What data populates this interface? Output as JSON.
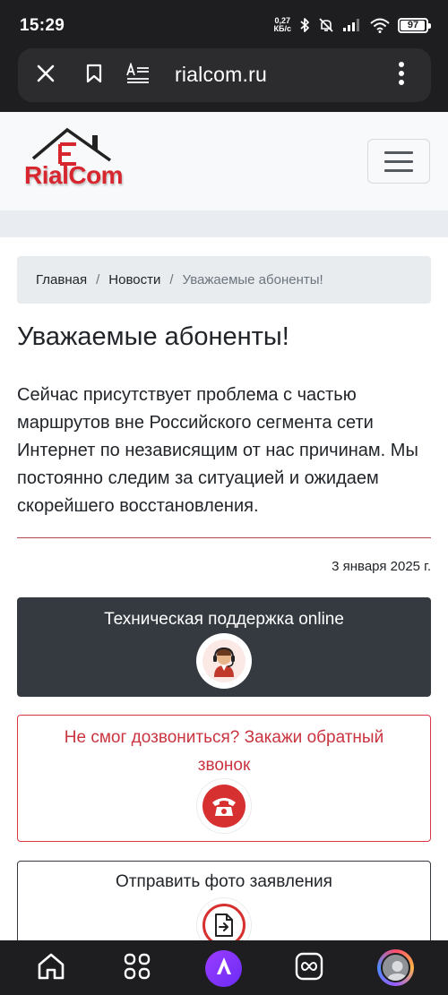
{
  "status_bar": {
    "time": "15:29",
    "net_speed_value": "0,27",
    "net_speed_unit": "КБ/с",
    "battery_level": "97",
    "icons": [
      "bluetooth-icon",
      "mute-icon",
      "signal-icon",
      "wifi-icon",
      "battery-icon"
    ]
  },
  "browser": {
    "url": "rialcom.ru",
    "icons": [
      "close-icon",
      "bookmark-icon",
      "reader-mode-icon",
      "more-vert-icon"
    ]
  },
  "header": {
    "logo_text": "RialCom",
    "menu_icon": "hamburger-menu-icon"
  },
  "breadcrumb": {
    "items": [
      "Главная",
      "Новости"
    ],
    "separator": "/",
    "current": "Уважаемые абоненты!"
  },
  "article": {
    "title": "Уважаемые абоненты!",
    "body": " Сейчас присутствует проблема с частью\nмаршрутов вне Российского сегмента сети\nИнтернет по независящим от нас причинам. Мы\nпостоянно следим за ситуацией и ожидаем\nскорейшего восстановления.",
    "date": "3 января 2025 г."
  },
  "cards": {
    "support": {
      "label": "Техническая поддержка online",
      "icon": "support-operator-icon"
    },
    "callback": {
      "label": "Не смог дозвониться? Закажи обратный звонок",
      "icon": "phone-icon"
    },
    "photo": {
      "label": "Отправить фото заявления",
      "icon": "send-document-icon"
    }
  },
  "bottom_nav": {
    "icons": [
      "home-icon",
      "apps-grid-icon",
      "alice-assistant-icon",
      "tabs-infinity-icon",
      "profile-avatar-icon"
    ]
  },
  "colors": {
    "system_bar": "#1e1e20",
    "brand_red": "#d7262e",
    "callback_red": "#dc3545",
    "support_dark": "#343a40"
  }
}
